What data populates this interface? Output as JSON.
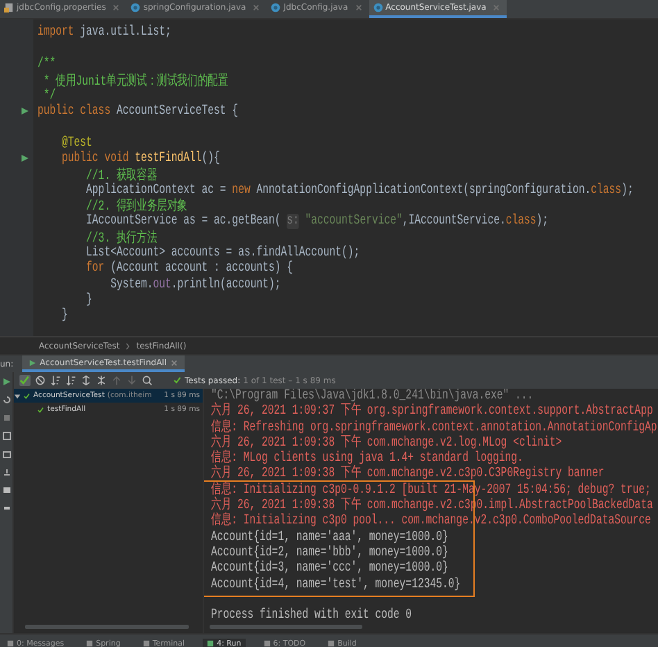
{
  "editor_tabs": [
    {
      "label": "jdbcConfig.properties",
      "kind": "properties",
      "selected": false
    },
    {
      "label": "springConfiguration.java",
      "kind": "class",
      "selected": false
    },
    {
      "label": "JdbcConfig.java",
      "kind": "class",
      "selected": false
    },
    {
      "label": "AccountServiceTest.java",
      "kind": "class",
      "selected": true
    }
  ],
  "editor": {
    "lines": [
      {
        "kind": "code",
        "run_marker": false,
        "segments": [
          {
            "text": "import",
            "kind": "keyword"
          },
          {
            "text": " java.util.List;",
            "kind": "plain"
          }
        ]
      },
      {
        "kind": "blank",
        "run_marker": false
      },
      {
        "kind": "code",
        "run_marker": false,
        "segments": [
          {
            "text": "/**",
            "kind": "comment"
          }
        ]
      },
      {
        "kind": "code",
        "run_marker": false,
        "segments": [
          {
            "text": " * 使用Junit单元测试：测试我们的配置",
            "kind": "comment"
          }
        ]
      },
      {
        "kind": "code",
        "run_marker": false,
        "segments": [
          {
            "text": " */",
            "kind": "comment"
          }
        ]
      },
      {
        "kind": "code",
        "run_marker": true,
        "segments": [
          {
            "text": "public class",
            "kind": "keyword"
          },
          {
            "text": " AccountServiceTest {",
            "kind": "plain"
          }
        ]
      },
      {
        "kind": "blank",
        "run_marker": false
      },
      {
        "kind": "code",
        "run_marker": false,
        "segments": [
          {
            "text": "    @Test",
            "kind": "annotation"
          }
        ]
      },
      {
        "kind": "code",
        "run_marker": true,
        "segments": [
          {
            "text": "    public void ",
            "kind": "keyword"
          },
          {
            "text": "testFindAll",
            "kind": "method"
          },
          {
            "text": "(){",
            "kind": "plain"
          }
        ]
      },
      {
        "kind": "code",
        "run_marker": false,
        "segments": [
          {
            "text": "        //1. 获取容器",
            "kind": "comment"
          }
        ]
      },
      {
        "kind": "code",
        "run_marker": false,
        "segments": [
          {
            "text": "        ApplicationContext ac = ",
            "kind": "plain"
          },
          {
            "text": "new",
            "kind": "keyword"
          },
          {
            "text": " AnnotationConfigApplicationContext(springConfiguration.",
            "kind": "plain"
          },
          {
            "text": "class",
            "kind": "keyword"
          },
          {
            "text": ");",
            "kind": "plain"
          }
        ]
      },
      {
        "kind": "code",
        "run_marker": false,
        "segments": [
          {
            "text": "        //2. 得到业务层对象",
            "kind": "comment"
          }
        ]
      },
      {
        "kind": "code",
        "run_marker": false,
        "segments": [
          {
            "text": "        IAccountService as = ac.getBean( ",
            "kind": "plain"
          },
          {
            "text": "s:",
            "kind": "hint"
          },
          {
            "text": " \"accountService\"",
            "kind": "string"
          },
          {
            "text": ",IAccountService.",
            "kind": "plain"
          },
          {
            "text": "class",
            "kind": "keyword"
          },
          {
            "text": ");",
            "kind": "plain"
          }
        ]
      },
      {
        "kind": "code",
        "run_marker": false,
        "segments": [
          {
            "text": "        //3. 执行方法",
            "kind": "comment"
          }
        ]
      },
      {
        "kind": "code",
        "run_marker": false,
        "segments": [
          {
            "text": "        List<Account> accounts = as.findAllAccount();",
            "kind": "plain"
          }
        ]
      },
      {
        "kind": "code",
        "run_marker": false,
        "segments": [
          {
            "text": "        for",
            "kind": "keyword"
          },
          {
            "text": " (Account account : accounts) {",
            "kind": "plain"
          }
        ]
      },
      {
        "kind": "code",
        "run_marker": false,
        "segments": [
          {
            "text": "            System.",
            "kind": "plain"
          },
          {
            "text": "out",
            "kind": "field"
          },
          {
            "text": ".println(account);",
            "kind": "plain"
          }
        ]
      },
      {
        "kind": "code",
        "run_marker": false,
        "segments": [
          {
            "text": "        }",
            "kind": "plain"
          }
        ]
      },
      {
        "kind": "code",
        "run_marker": false,
        "segments": [
          {
            "text": "    }",
            "kind": "plain"
          }
        ]
      }
    ]
  },
  "breadcrumb": [
    "AccountServiceTest",
    "testFindAll()"
  ],
  "run_panel": {
    "label": "un:",
    "tab": "AccountServiceTest.testFindAll",
    "status": "Tests passed:",
    "status_detail": "1 of 1 test – 1 s 89 ms",
    "tests": [
      {
        "name": "AccountServiceTest",
        "detail": "(com.itheim",
        "time": "1 s 89 ms",
        "selected": true,
        "expanded": true,
        "children": [
          {
            "name": "testFindAll",
            "time": "1 s 89 ms",
            "selected": false
          }
        ]
      }
    ],
    "console": [
      {
        "kind": "command",
        "text": "\"C:\\Program Files\\Java\\jdk1.8.0_241\\bin\\java.exe\" ..."
      },
      {
        "kind": "error",
        "text": "六月 26, 2021 1:09:37 下午 org.springframework.context.support.AbstractApp"
      },
      {
        "kind": "error",
        "text": "信息: Refreshing org.springframework.context.annotation.AnnotationConfigAp"
      },
      {
        "kind": "error",
        "text": "六月 26, 2021 1:09:38 下午 com.mchange.v2.log.MLog <clinit>"
      },
      {
        "kind": "error",
        "text": "信息: MLog clients using java 1.4+ standard logging."
      },
      {
        "kind": "error",
        "text": "六月 26, 2021 1:09:38 下午 com.mchange.v2.c3p0.C3P0Registry banner"
      },
      {
        "kind": "error",
        "text": "信息: Initializing c3p0-0.9.1.2 [built 21-May-2007 15:04:56; debug? true;"
      },
      {
        "kind": "error",
        "text": "六月 26, 2021 1:09:38 下午 com.mchange.v2.c3p0.impl.AbstractPoolBackedData"
      },
      {
        "kind": "error",
        "text": "信息: Initializing c3p0 pool... com.mchange.v2.c3p0.ComboPooledDataSource"
      },
      {
        "kind": "output",
        "text": "Account{id=1, name='aaa', money=1000.0}"
      },
      {
        "kind": "output",
        "text": "Account{id=2, name='bbb', money=1000.0}"
      },
      {
        "kind": "output",
        "text": "Account{id=3, name='ccc', money=1000.0}"
      },
      {
        "kind": "output",
        "text": "Account{id=4, name='test', money=12345.0}"
      },
      {
        "kind": "blank"
      },
      {
        "kind": "output",
        "text": "Process finished with exit code 0"
      }
    ]
  },
  "tool_windows": [
    {
      "label": "0: Messages",
      "selected": false
    },
    {
      "label": "Spring",
      "selected": false
    },
    {
      "label": "Terminal",
      "selected": false
    },
    {
      "label": "4: Run",
      "selected": true
    },
    {
      "label": "6: TODO",
      "selected": false
    },
    {
      "label": "Build",
      "selected": false
    }
  ]
}
